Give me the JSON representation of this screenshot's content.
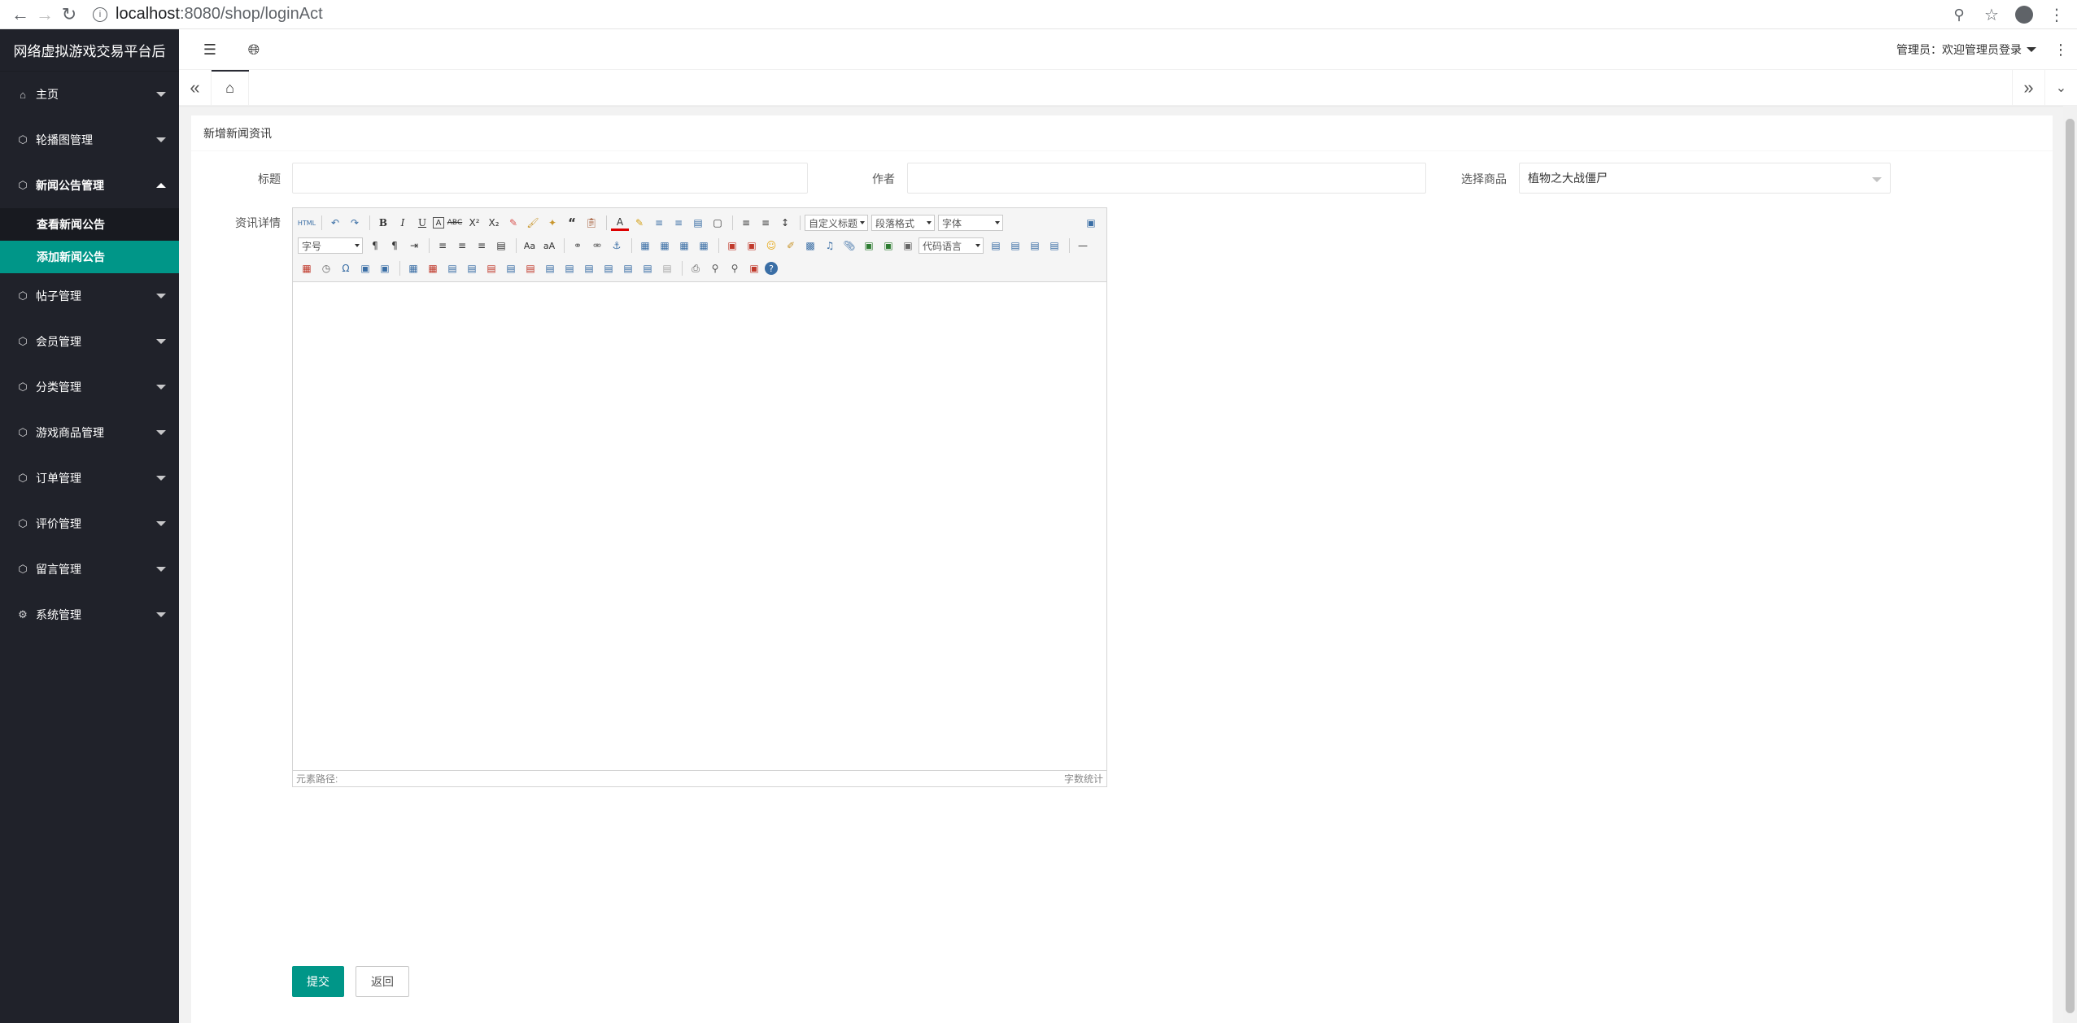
{
  "browser": {
    "url_host": "localhost",
    "url_rest": ":8080/shop/loginAct"
  },
  "sidebar": {
    "brand": "网络虚拟游戏交易平台后",
    "items": [
      {
        "label": "主页",
        "icon": "home-icon"
      },
      {
        "label": "轮播图管理",
        "icon": "cube-icon"
      },
      {
        "label": "新闻公告管理",
        "icon": "cube-icon",
        "open": true,
        "children": [
          {
            "label": "查看新闻公告"
          },
          {
            "label": "添加新闻公告",
            "active": true
          }
        ]
      },
      {
        "label": "帖子管理",
        "icon": "cube-icon"
      },
      {
        "label": "会员管理",
        "icon": "cube-icon"
      },
      {
        "label": "分类管理",
        "icon": "cube-icon"
      },
      {
        "label": "游戏商品管理",
        "icon": "cube-icon"
      },
      {
        "label": "订单管理",
        "icon": "cube-icon"
      },
      {
        "label": "评价管理",
        "icon": "cube-icon"
      },
      {
        "label": "留言管理",
        "icon": "cube-icon"
      },
      {
        "label": "系统管理",
        "icon": "gear-icon"
      }
    ]
  },
  "header": {
    "user_label": "管理员：欢迎管理员登录"
  },
  "card": {
    "title": "新增新闻资讯"
  },
  "form": {
    "title_label": "标题",
    "title_value": "",
    "author_label": "作者",
    "author_value": "",
    "goods_label": "选择商品",
    "goods_value": "植物之大战僵尸",
    "detail_label": "资讯详情"
  },
  "editor": {
    "heading_combo": "自定义标题",
    "paragraph_combo": "段落格式",
    "font_combo": "字体",
    "size_combo": "字号",
    "code_combo": "代码语言",
    "path_label": "元素路径:",
    "word_count": "字数统计"
  },
  "buttons": {
    "submit": "提交",
    "back": "返回"
  },
  "colors": {
    "sidebar_bg": "#20222a",
    "accent": "#009688"
  }
}
